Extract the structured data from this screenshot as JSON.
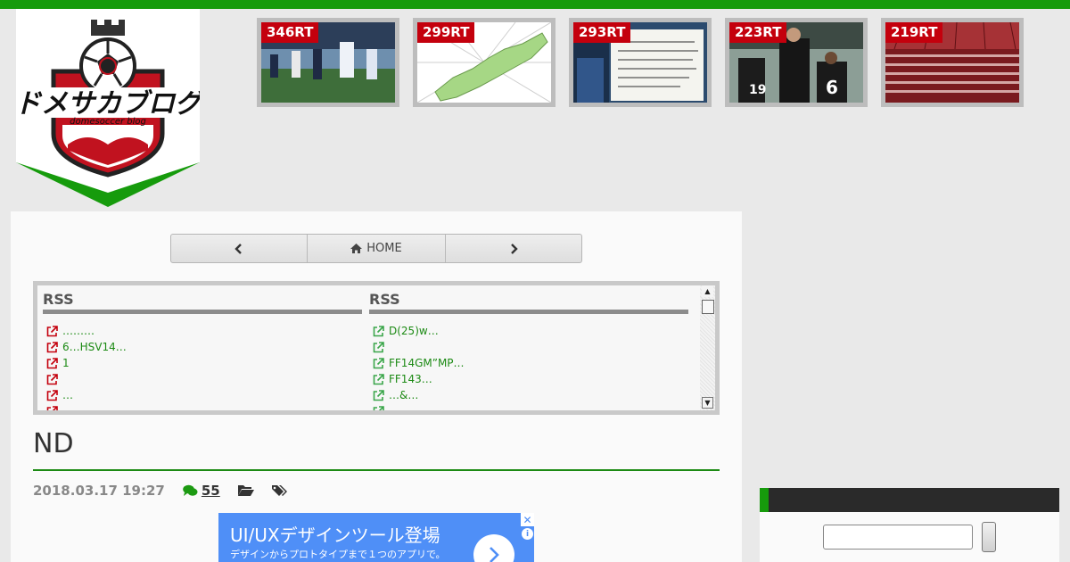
{
  "colors": {
    "accent_green": "#169b0c",
    "rt_badge": "#c4000d",
    "link_green": "#1c8a14",
    "ad_blue": "#4f8ff7"
  },
  "logo": {
    "icon": "soccer-crest-logo",
    "text": "ドメサカブログ",
    "subtext": "domesoccer blog"
  },
  "thumbnails": [
    {
      "rt": "346RT",
      "sign_text": ""
    },
    {
      "rt": "299RT",
      "sign_text": ""
    },
    {
      "rt": "293RT",
      "sign_text": "山形サポーターの皆様へ。"
    },
    {
      "rt": "223RT",
      "sign_text": ""
    },
    {
      "rt": "219RT",
      "sign_text": ""
    }
  ],
  "pager": {
    "home_label": "HOME",
    "prev_icon": "chevron-left-icon",
    "next_icon": "chevron-right-icon",
    "home_icon": "home-icon"
  },
  "rss": {
    "left": {
      "heading": "RSS",
      "items": [
        "………",
        "6…HSV14…",
        "1",
        "",
        "…",
        ""
      ]
    },
    "right": {
      "heading": "RSS",
      "items": [
        "D(25)w…",
        "",
        "FF14GM”MP…",
        "FF143…",
        "…&…",
        ""
      ]
    }
  },
  "post": {
    "title": "ND",
    "date": "2018.03.17 19:27",
    "comment_count": "55"
  },
  "ad": {
    "headline": "UI/UXデザインツール登場",
    "sub": "デザインからプロトタイプまで１つのアプリで。",
    "close": "✕",
    "info": "i"
  }
}
